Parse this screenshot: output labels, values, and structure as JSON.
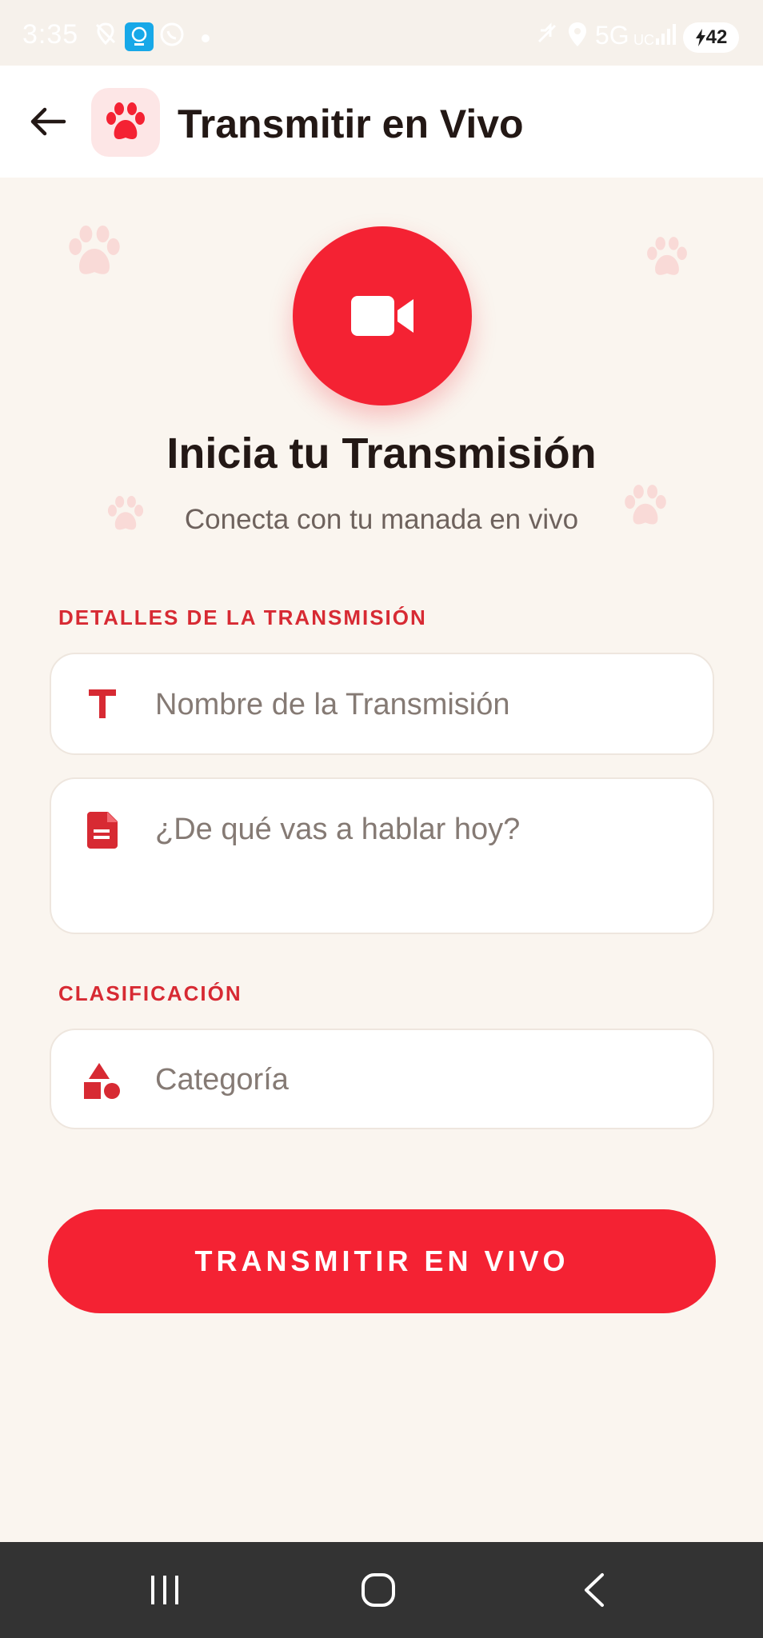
{
  "status_bar": {
    "time": "3:35",
    "network": "5G",
    "network_sub": "UC",
    "battery": "42",
    "icons": [
      "location-off-icon",
      "app-notification-icon",
      "whatsapp-icon",
      "dot-icon",
      "mute-icon",
      "location-icon",
      "signal-icon",
      "charging-icon"
    ]
  },
  "app_bar": {
    "title": "Transmitir en Vivo",
    "back_icon": "arrow-left-icon",
    "logo_icon": "paw-icon"
  },
  "hero": {
    "icon": "video-camera-icon",
    "title": "Inicia tu Transmisión",
    "subtitle": "Conecta con tu manada en vivo"
  },
  "details_section": {
    "label": "DETALLES DE LA TRANSMISIÓN",
    "name_field": {
      "icon": "title-text-icon",
      "placeholder": "Nombre de la Transmisión",
      "value": ""
    },
    "description_field": {
      "icon": "document-icon",
      "placeholder": "¿De qué vas a hablar hoy?",
      "value": ""
    }
  },
  "classification_section": {
    "label": "CLASIFICACIÓN",
    "category_field": {
      "icon": "category-shapes-icon",
      "placeholder": "Categoría",
      "value": ""
    }
  },
  "primary_action": {
    "label": "TRANSMITIR EN VIVO"
  },
  "nav_bar": {
    "buttons": [
      "recent-apps-icon",
      "home-icon",
      "back-icon"
    ]
  },
  "colors": {
    "accent": "#F42233",
    "section_label": "#D72A33",
    "background": "#FAF5EF",
    "text_primary": "#231815",
    "text_secondary": "#6E625D",
    "placeholder": "#857A74"
  }
}
